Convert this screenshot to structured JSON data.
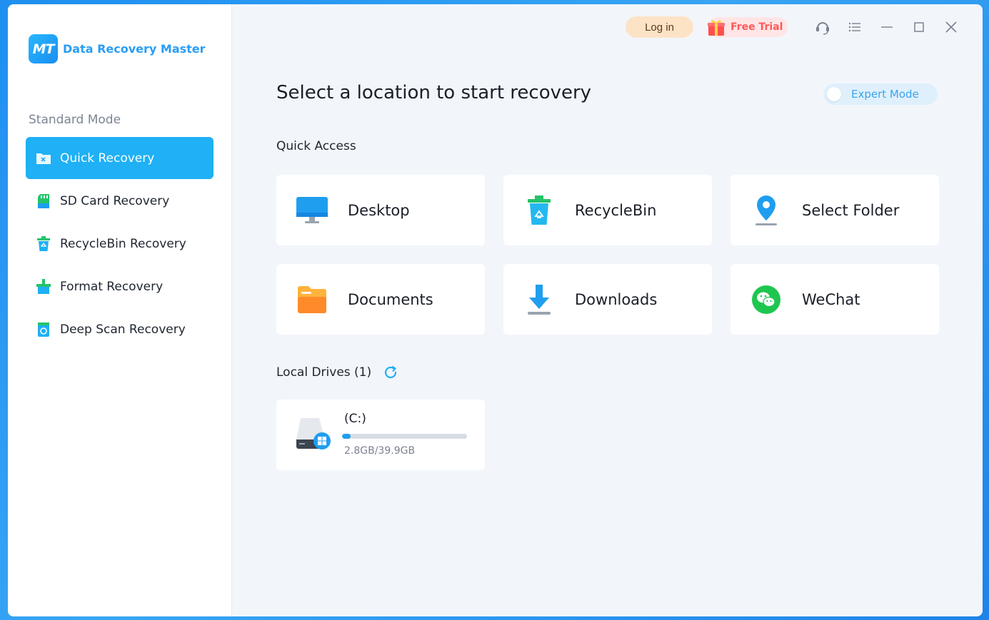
{
  "app": {
    "logo_mark": "MT",
    "name": "Data Recovery Master"
  },
  "sidebar": {
    "mode_label": "Standard Mode",
    "items": [
      {
        "label": "Quick Recovery",
        "icon": "folder-x-icon",
        "active": true
      },
      {
        "label": "SD Card Recovery",
        "icon": "sd-card-icon",
        "active": false
      },
      {
        "label": "RecycleBin Recovery",
        "icon": "recycle-bin-icon",
        "active": false
      },
      {
        "label": "Format Recovery",
        "icon": "format-icon",
        "active": false
      },
      {
        "label": "Deep Scan Recovery",
        "icon": "deep-scan-icon",
        "active": false
      }
    ]
  },
  "topbar": {
    "login_label": "Log in",
    "trial_label": "Free Trial",
    "icons": [
      "support-icon",
      "menu-icon",
      "minimize-icon",
      "maximize-icon",
      "close-icon"
    ]
  },
  "main": {
    "title": "Select a location to start recovery",
    "expert_mode_label": "Expert Mode",
    "expert_mode_on": false,
    "quick_access_label": "Quick Access",
    "quick_access": [
      {
        "label": "Desktop",
        "icon": "desktop-icon"
      },
      {
        "label": "RecycleBin",
        "icon": "recycle-bin-icon"
      },
      {
        "label": "Select Folder",
        "icon": "location-pin-icon"
      },
      {
        "label": "Documents",
        "icon": "documents-folder-icon"
      },
      {
        "label": "Downloads",
        "icon": "download-icon"
      },
      {
        "label": "WeChat",
        "icon": "wechat-icon"
      }
    ],
    "local_drives_label": "Local Drives (1)",
    "drives": [
      {
        "name": "(C:)",
        "size_text": "2.8GB/39.9GB",
        "used_fraction": 0.07
      }
    ]
  },
  "colors": {
    "accent": "#1fb0f5",
    "brand_text": "#2a9df4",
    "trial": "#ff5a5a",
    "login_bg": "#fde3c5"
  }
}
